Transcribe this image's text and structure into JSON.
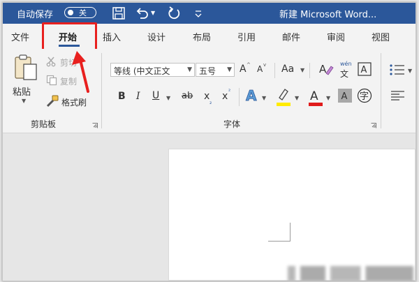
{
  "titlebar": {
    "autosave_label": "自动保存",
    "autosave_state": "关",
    "window_title": "新建 Microsoft Word...",
    "background": "#2b579a"
  },
  "tabs": [
    {
      "label": "文件"
    },
    {
      "label": "开始",
      "selected": true
    },
    {
      "label": "插入"
    },
    {
      "label": "设计"
    },
    {
      "label": "布局"
    },
    {
      "label": "引用"
    },
    {
      "label": "邮件"
    },
    {
      "label": "审阅"
    },
    {
      "label": "视图"
    }
  ],
  "clipboard": {
    "paste_label": "粘贴",
    "cut_label": "剪切",
    "copy_label": "复制",
    "format_painter_label": "格式刷",
    "group_label": "剪贴板"
  },
  "font": {
    "font_name": "等线 (中文正文",
    "font_size": "五号",
    "bold": "B",
    "italic": "I",
    "underline": "U",
    "strikethrough": "ab",
    "subscript": "x",
    "superscript": "x",
    "grow": "A",
    "shrink": "A",
    "change_case": "Aa",
    "phonetic_top": "wén",
    "phonetic_bottom": "文",
    "group_label": "字体"
  },
  "colors": {
    "accent": "#2b579a",
    "highlight_box": "#e8201f",
    "highlight_yellow": "#ffeb00",
    "font_red": "#e01b1b"
  }
}
